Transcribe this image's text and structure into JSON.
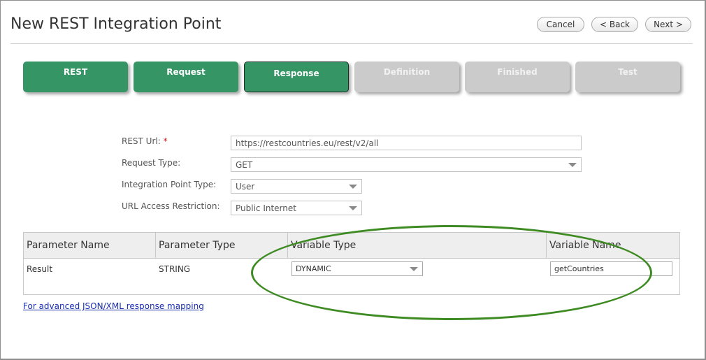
{
  "page": {
    "title": "New REST Integration Point"
  },
  "header_buttons": {
    "cancel": "Cancel",
    "back": "< Back",
    "next": "Next >"
  },
  "steps": [
    {
      "label": "REST",
      "state": "done"
    },
    {
      "label": "Request",
      "state": "done"
    },
    {
      "label": "Response",
      "state": "active"
    },
    {
      "label": "Definition",
      "state": "todo"
    },
    {
      "label": "Finished",
      "state": "todo"
    },
    {
      "label": "Test",
      "state": "todo"
    }
  ],
  "form": {
    "rest_url": {
      "label": "REST Url:",
      "required_mark": "*",
      "value": "https://restcountries.eu/rest/v2/all"
    },
    "request_type": {
      "label": "Request Type:",
      "value": "GET"
    },
    "integration_point_type": {
      "label": "Integration Point Type:",
      "value": "User"
    },
    "url_access_restriction": {
      "label": "URL Access Restriction:",
      "value": "Public Internet"
    }
  },
  "grid": {
    "columns": [
      "Parameter Name",
      "Parameter Type",
      "Variable Type",
      "Variable Name"
    ],
    "rows": [
      {
        "parameter_name": "Result",
        "parameter_type": "STRING",
        "variable_type": "DYNAMIC",
        "variable_name": "getCountries"
      }
    ]
  },
  "advanced_link": "For advanced JSON/XML response mapping",
  "colors": {
    "step_complete": "#359565",
    "step_pending": "#cbcbcb",
    "highlight": "#3f8b23",
    "link": "#1a2fb0"
  }
}
